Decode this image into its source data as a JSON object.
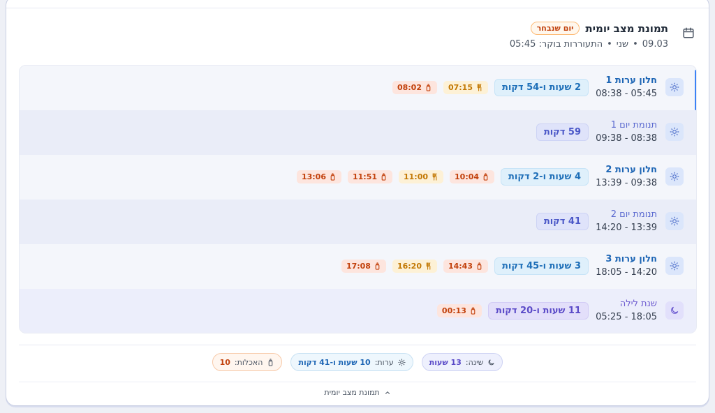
{
  "header": {
    "title": "תמונת מצב יומית",
    "day_badge": "יום שנבחר",
    "date": "09.03",
    "weekday": "שני",
    "wake_label": "התעוררות בוקר: 05:45"
  },
  "rows": [
    {
      "name": "חלון ערות 1",
      "time": "08:38 - 05:45",
      "duration": "2 שעות ו-54 דקות",
      "events": [
        {
          "type": "meal",
          "time": "07:15",
          "icon": "utensils-icon"
        },
        {
          "type": "feed",
          "time": "08:02",
          "icon": "bottle-icon"
        }
      ]
    },
    {
      "name": "תנומת יום 1",
      "time": "09:38 - 08:38",
      "duration": "59 דקות",
      "events": []
    },
    {
      "name": "חלון ערות 2",
      "time": "13:39 - 09:38",
      "duration": "4 שעות ו-2 דקות",
      "events": [
        {
          "type": "feed",
          "time": "10:04",
          "icon": "bottle-icon"
        },
        {
          "type": "meal",
          "time": "11:00",
          "icon": "utensils-icon"
        },
        {
          "type": "feed",
          "time": "11:51",
          "icon": "bottle-icon"
        },
        {
          "type": "feed",
          "time": "13:06",
          "icon": "bottle-icon"
        }
      ]
    },
    {
      "name": "תנומת יום 2",
      "time": "14:20 - 13:39",
      "duration": "41 דקות",
      "events": []
    },
    {
      "name": "חלון ערות 3",
      "time": "18:05 - 14:20",
      "duration": "3 שעות ו-45 דקות",
      "events": [
        {
          "type": "feed",
          "time": "14:43",
          "icon": "bottle-icon"
        },
        {
          "type": "meal",
          "time": "16:20",
          "icon": "utensils-icon"
        },
        {
          "type": "feed",
          "time": "17:08",
          "icon": "bottle-icon"
        }
      ]
    },
    {
      "name": "שנת לילה",
      "time": "05:25 - 18:05",
      "duration": "11 שעות ו-20 דקות",
      "events": [
        {
          "type": "feed",
          "time": "00:13",
          "icon": "bottle-icon"
        }
      ]
    }
  ],
  "totals": {
    "sleep_label": "שינה:",
    "sleep_value": "13 שעות",
    "awake_label": "ערות:",
    "awake_value": "10 שעות ו-41 דקות",
    "meals_label": "האכלות:",
    "meals_value": "10"
  },
  "footer": {
    "toggle_label": "תמונת מצב יומית"
  },
  "colors": {
    "accent": "#3b82f6",
    "awake": "#1e66b5",
    "sleep": "#5b4bc8",
    "feed": "#c2410c",
    "meal": "#c27803"
  }
}
